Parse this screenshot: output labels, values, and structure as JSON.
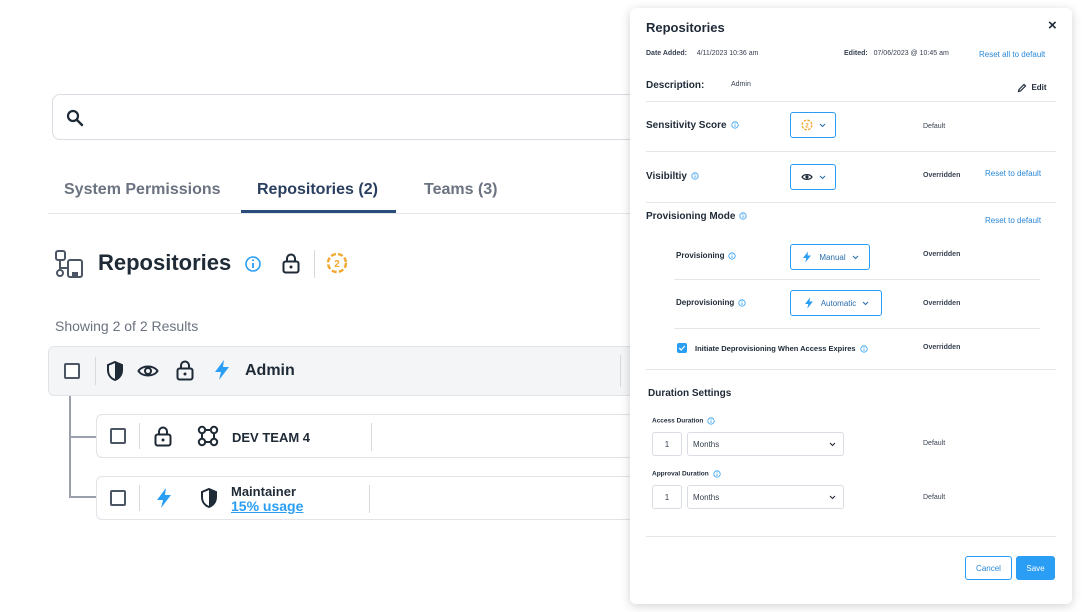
{
  "search": {
    "placeholder": ""
  },
  "tabs": [
    {
      "label": "System Permissions"
    },
    {
      "label": "Repositories  (2)"
    },
    {
      "label": "Teams (3)"
    }
  ],
  "section": {
    "title": "Repositories",
    "score": "2"
  },
  "results_text": "Showing 2 of 2 Results",
  "rows": {
    "main": {
      "label": "Admin"
    },
    "sub1": {
      "label": "DEV TEAM 4"
    },
    "sub2": {
      "label": "Maintainer",
      "usage": "15% usage"
    }
  },
  "panel": {
    "title": "Repositories",
    "close": "×",
    "date_added_label": "Date Added:",
    "date_added_value": "4/11/2023  10:36 am",
    "edited_label": "Edited:",
    "edited_value": "07/06/2023 @ 10:45 am",
    "reset_all": "Reset all to default",
    "description_label": "Description:",
    "description_value": "Admin",
    "edit_label": "Edit",
    "sensitivity": {
      "label": "Sensitivity Score",
      "score": "2",
      "status": "Default"
    },
    "visibility": {
      "label": "Visibiltiy",
      "status": "Overridden",
      "reset": "Reset to default"
    },
    "provisioning_mode": {
      "label": "Provisioning Mode",
      "reset": "Reset to default"
    },
    "provisioning": {
      "label": "Provisioning",
      "value": "Manual",
      "status": "Overridden"
    },
    "deprovisioning": {
      "label": "Deprovisioning",
      "value": "Automatic",
      "status": "Overridden"
    },
    "initiate": {
      "label": "Initiate Deprovisioning When Access Expires",
      "status": "Overridden",
      "checked": true
    },
    "duration": {
      "title": "Duration Settings",
      "access_label": "Access Duration",
      "access_number": "1",
      "access_unit": "Months",
      "access_status": "Default",
      "approval_label": "Approval Duration",
      "approval_number": "1",
      "approval_unit": "Months",
      "approval_status": "Default"
    },
    "cancel": "Cancel",
    "save": "Save"
  },
  "colors": {
    "accent": "#2a9df4",
    "score": "#f0a830",
    "tab_active": "#2a4d7c"
  }
}
